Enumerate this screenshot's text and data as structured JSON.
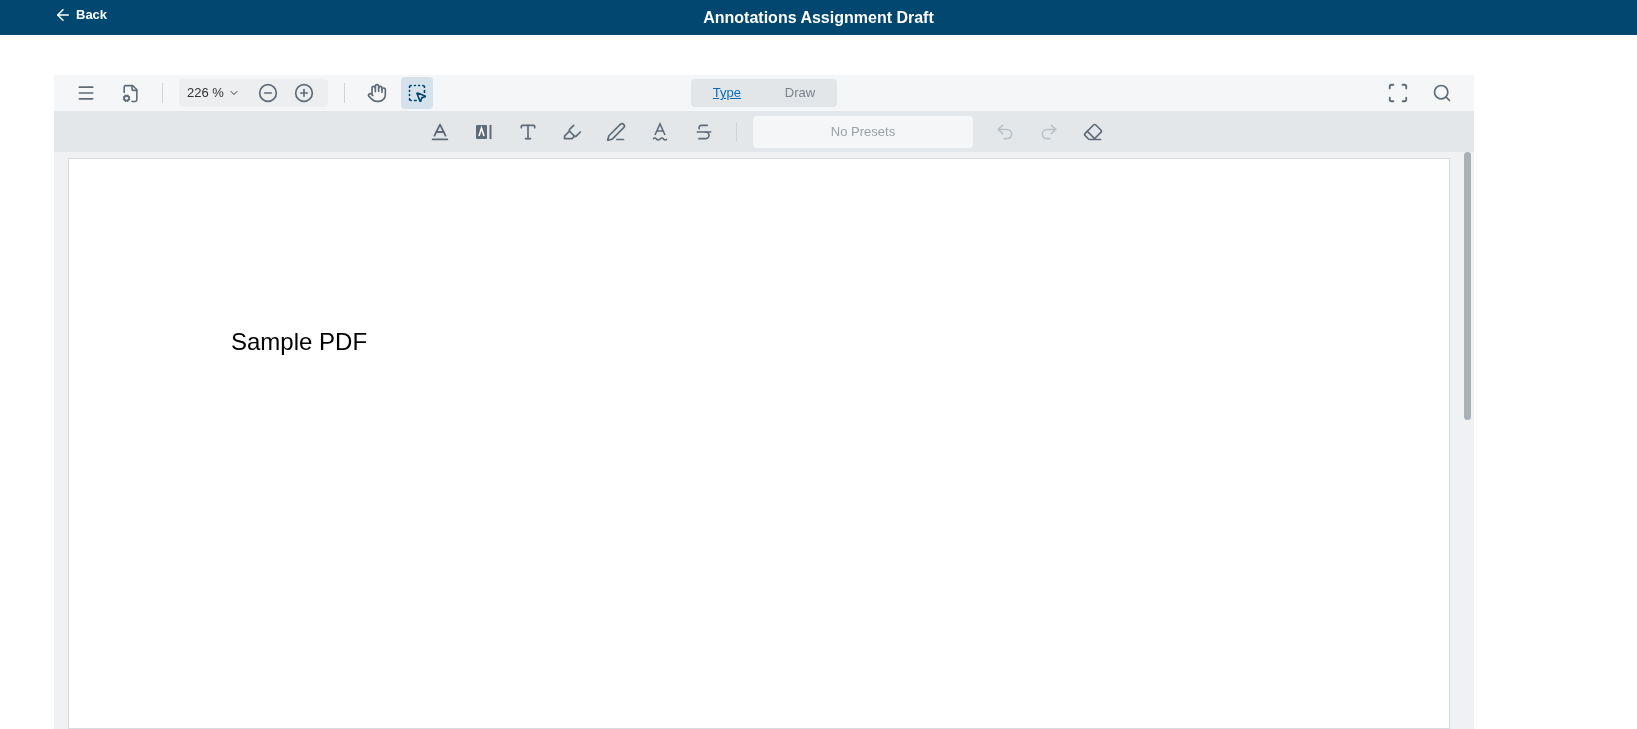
{
  "header": {
    "back": "Back",
    "title": "Annotations Assignment Draft"
  },
  "toolbar": {
    "zoom": "226 %",
    "tools": [
      {
        "kind": "pan",
        "selected": false
      },
      {
        "kind": "select",
        "selected": true
      }
    ],
    "modes": [
      {
        "label": "Type",
        "selected": true
      },
      {
        "label": "Draw",
        "selected": false
      }
    ]
  },
  "annotation_bar": {
    "presets": {
      "placeholder": "No Presets"
    },
    "undo": {
      "disabled": true
    },
    "redo": {
      "disabled": true
    }
  },
  "document": {
    "text": "Sample PDF"
  }
}
